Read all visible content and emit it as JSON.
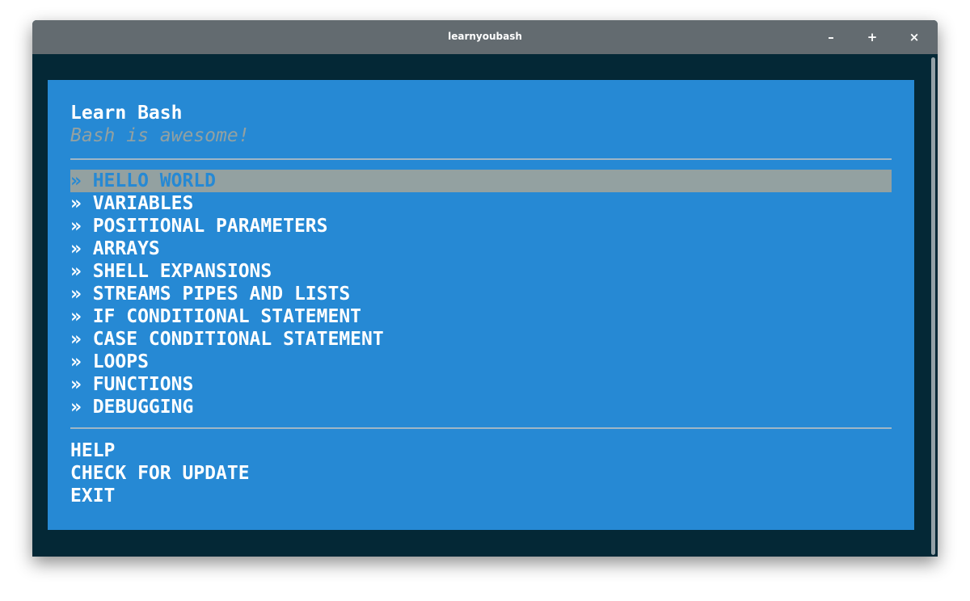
{
  "window": {
    "title": "learnyoubash",
    "minimize_label": "–",
    "maximize_label": "+",
    "close_label": "×"
  },
  "header": {
    "title": "Learn Bash",
    "subtitle": "Bash is awesome!"
  },
  "menu": {
    "selected_index": 0,
    "items": [
      {
        "label": "» HELLO WORLD"
      },
      {
        "label": "» VARIABLES"
      },
      {
        "label": "» POSITIONAL PARAMETERS"
      },
      {
        "label": "» ARRAYS"
      },
      {
        "label": "» SHELL EXPANSIONS"
      },
      {
        "label": "» STREAMS PIPES AND LISTS"
      },
      {
        "label": "» IF CONDITIONAL STATEMENT"
      },
      {
        "label": "» CASE CONDITIONAL STATEMENT"
      },
      {
        "label": "» LOOPS"
      },
      {
        "label": "» FUNCTIONS"
      },
      {
        "label": "» DEBUGGING"
      }
    ]
  },
  "extras": {
    "items": [
      {
        "label": "HELP"
      },
      {
        "label": "CHECK FOR UPDATE"
      },
      {
        "label": "EXIT"
      }
    ]
  },
  "colors": {
    "terminal_background": "#042836",
    "menu_background": "#2689d4",
    "selection_highlight": "#93a1a1",
    "subtitle_text": "#93a1a1",
    "text": "#ffffff",
    "titlebar": "#636b70"
  }
}
